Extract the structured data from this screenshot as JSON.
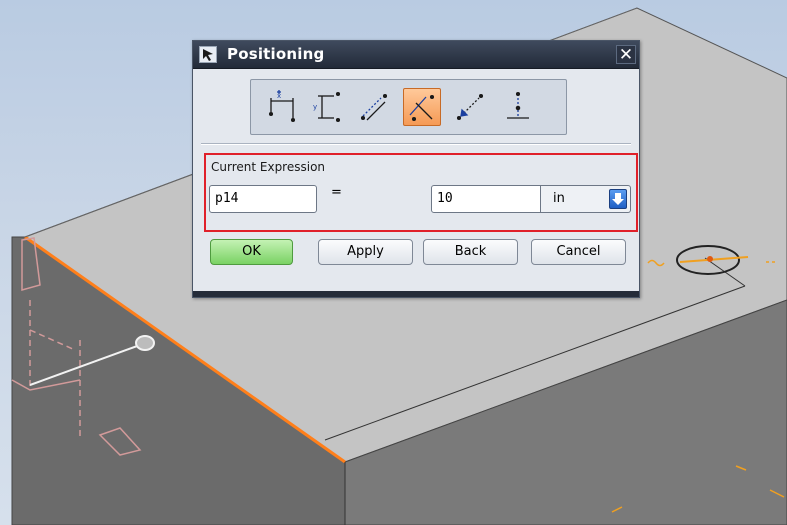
{
  "dialog": {
    "title": "Positioning",
    "close_label": "✕",
    "methods": [
      {
        "name": "horizontal",
        "icon": "horizontal-dimension-icon",
        "active": false
      },
      {
        "name": "vertical",
        "icon": "vertical-dimension-icon",
        "active": false
      },
      {
        "name": "parallel",
        "icon": "parallel-dimension-icon",
        "active": false
      },
      {
        "name": "perpendicular",
        "icon": "perpendicular-dimension-icon",
        "active": true
      },
      {
        "name": "point-onto-point",
        "icon": "point-onto-point-icon",
        "active": false
      },
      {
        "name": "point-onto-line",
        "icon": "point-onto-line-icon",
        "active": false
      }
    ],
    "expression": {
      "group_label": "Current Expression",
      "name_value": "p14",
      "equals": "=",
      "value": "10",
      "unit": "in"
    },
    "buttons": {
      "ok": "OK",
      "apply": "Apply",
      "back": "Back",
      "cancel": "Cancel"
    }
  },
  "colors": {
    "highlight_box": "#e0202a",
    "active_tool": "#f59a55",
    "selected_edge": "#ff7f1a",
    "ok_button": "#7ad264",
    "viewport_background": "#c8d5e6"
  }
}
